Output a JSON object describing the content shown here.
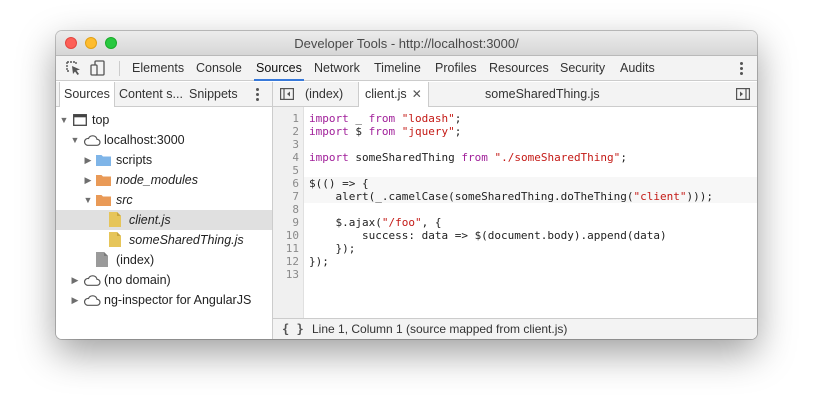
{
  "window": {
    "title": "Developer Tools - http://localhost:3000/"
  },
  "toolbar": {
    "icons": [
      "inspect-element-icon",
      "device-mode-icon",
      "more-menu-icon"
    ],
    "tabs": [
      "Elements",
      "Console",
      "Sources",
      "Network",
      "Timeline",
      "Profiles",
      "Resources",
      "Security",
      "Audits"
    ],
    "active_tab": "Sources"
  },
  "navigator": {
    "tabs": [
      "Sources",
      "Content s...",
      "Snippets"
    ],
    "active_tab": "Sources",
    "tree": [
      {
        "label": "top",
        "icon": "frame-icon",
        "expanded": true
      },
      {
        "label": "localhost:3000",
        "icon": "cloud-icon",
        "expanded": true
      },
      {
        "label": "scripts",
        "icon": "folder-blue-icon",
        "expanded": false
      },
      {
        "label": "node_modules",
        "icon": "folder-orange-icon",
        "expanded": false
      },
      {
        "label": "src",
        "icon": "folder-orange-icon",
        "expanded": true
      },
      {
        "label": "client.js",
        "icon": "file-yellow-icon",
        "selected": true
      },
      {
        "label": "someSharedThing.js",
        "icon": "file-yellow-icon"
      },
      {
        "label": "(index)",
        "icon": "file-gray-icon"
      },
      {
        "label": "(no domain)",
        "icon": "cloud-icon",
        "expanded": false
      },
      {
        "label": "ng-inspector for AngularJS",
        "icon": "cloud-icon",
        "expanded": false
      }
    ]
  },
  "editor": {
    "tabs": [
      "(index)",
      "client.js",
      "someSharedThing.js"
    ],
    "active_tab": "client.js",
    "line_numbers": [
      "1",
      "2",
      "3",
      "4",
      "5",
      "6",
      "7",
      "8",
      "9",
      "10",
      "11",
      "12",
      "13"
    ],
    "lines": [
      "import _ from \"lodash\";",
      "import $ from \"jquery\";",
      "",
      "import someSharedThing from \"./someSharedThing\";",
      "",
      "$(() => {",
      "    alert(_.camelCase(someSharedThing.doTheThing(\"client\")));",
      "",
      "    $.ajax(\"/foo\", {",
      "        success: data => $(document.body).append(data)",
      "    });",
      "});",
      ""
    ]
  },
  "status": {
    "pretty_print": "{ }",
    "position": "Line 1, Column 1",
    "source_map": "(source mapped from client.js)"
  },
  "colors": {
    "keyword": "#a1209a",
    "string": "#c41a16",
    "accent": "#3879d9",
    "folder_blue": "#7fb5e8",
    "folder_orange": "#e99a57",
    "file_yellow": "#e6c55a"
  }
}
